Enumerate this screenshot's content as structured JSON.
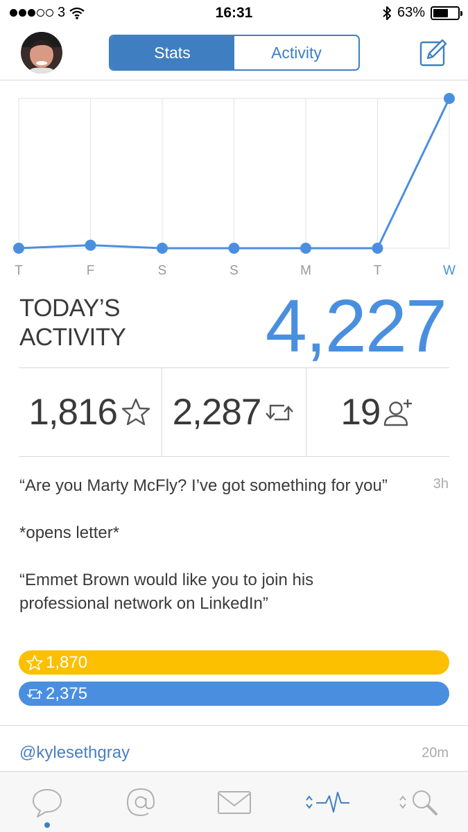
{
  "status_bar": {
    "carrier": "3",
    "time": "16:31",
    "battery_percent_label": "63%",
    "battery_level": 0.63
  },
  "nav": {
    "tabs": [
      {
        "label": "Stats",
        "active": true
      },
      {
        "label": "Activity",
        "active": false
      }
    ],
    "compose_icon": "compose-icon"
  },
  "chart_data": {
    "type": "line",
    "categories": [
      "T",
      "F",
      "S",
      "S",
      "M",
      "T",
      "W"
    ],
    "values": [
      0,
      2,
      0,
      0,
      0,
      0,
      100
    ],
    "ylim": [
      0,
      100
    ],
    "grid": true,
    "highlight_last": true,
    "line_color": "#4a8fdf"
  },
  "today": {
    "label_line1": "TODAY’S",
    "label_line2": "ACTIVITY",
    "value": "4,227"
  },
  "stats": [
    {
      "value": "1,816",
      "icon": "star-icon"
    },
    {
      "value": "2,287",
      "icon": "retweet-icon"
    },
    {
      "value": "19",
      "icon": "add-follower-icon"
    }
  ],
  "tweet": {
    "paragraphs": [
      "“Are you Marty McFly? I’ve got something for you”",
      "*opens letter*",
      "“Emmet Brown would like you to join his professional network on LinkedIn”"
    ],
    "time": "3h",
    "favorites": "1,870",
    "retweets": "2,375",
    "favorites_fraction": 1.0,
    "retweets_fraction": 1.0
  },
  "next_tweet": {
    "handle": "@kylesethgray",
    "time": "20m"
  },
  "tab_bar": {
    "items": [
      {
        "icon": "speech-bubble-icon",
        "active": true
      },
      {
        "icon": "mention-icon",
        "active": false
      },
      {
        "icon": "mail-icon",
        "active": false
      },
      {
        "icon": "activity-icon",
        "active": false
      },
      {
        "icon": "search-icon",
        "active": false
      }
    ]
  },
  "colors": {
    "accent": "#3f7fc1",
    "chart_blue": "#4a8fdf",
    "favorite_yellow": "#fcc000"
  }
}
